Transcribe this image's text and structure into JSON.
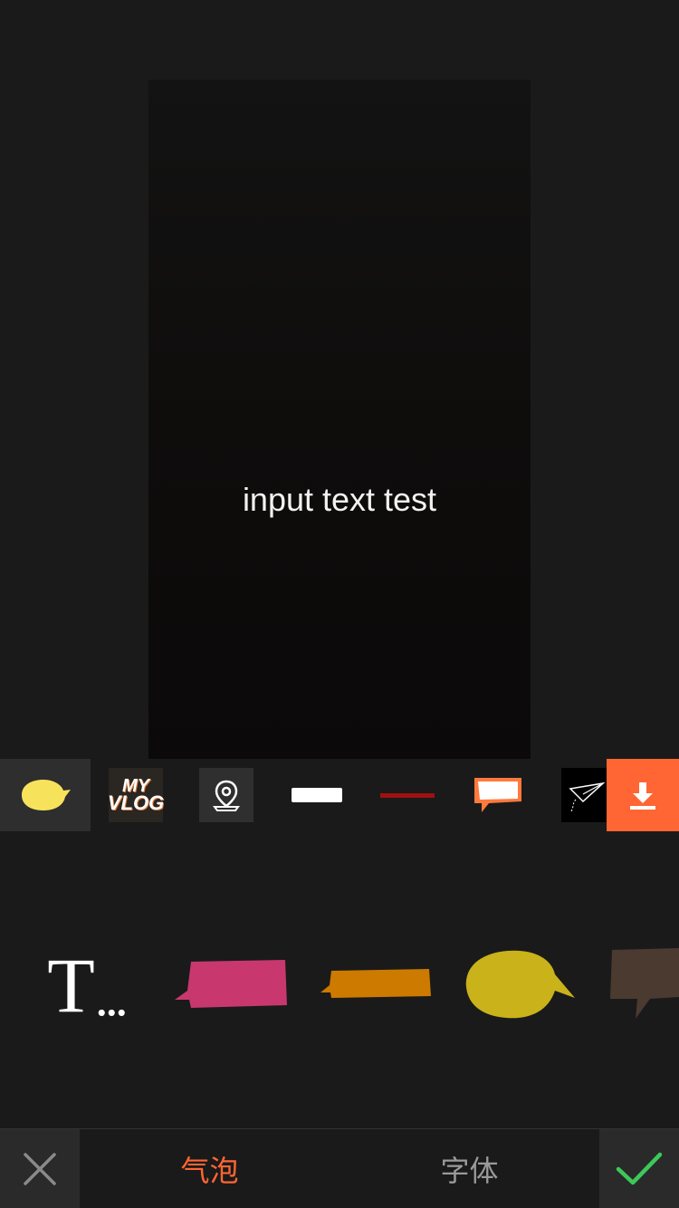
{
  "preview": {
    "overlay_text": "input text test"
  },
  "category_strip": {
    "items": [
      {
        "icon": "yellow-bubble-icon",
        "selected": true
      },
      {
        "icon": "my-vlog-icon",
        "text_line1": "MY",
        "text_line2": "VLOG"
      },
      {
        "icon": "location-pin-icon"
      },
      {
        "icon": "white-bar-icon"
      },
      {
        "icon": "red-line-icon"
      },
      {
        "icon": "orange-speech-bubble-icon"
      },
      {
        "icon": "paper-plane-icon"
      }
    ],
    "download_icon": "download-icon"
  },
  "styles": {
    "text_only_glyph": "T",
    "text_only_dots": "...",
    "items": [
      {
        "icon": "pink-rect-bubble-icon",
        "color": "#c8386e"
      },
      {
        "icon": "orange-rect-bubble-icon",
        "color": "#cc7a00"
      },
      {
        "icon": "yellow-round-bubble-icon",
        "color": "#c9b21a"
      },
      {
        "icon": "brown-speech-bubble-icon",
        "color": "#4a3a30"
      }
    ]
  },
  "bottom_bar": {
    "cancel_icon": "close-icon",
    "tab_bubble": "气泡",
    "tab_font": "字体",
    "confirm_icon": "check-icon"
  },
  "colors": {
    "accent": "#ff6633",
    "confirm": "#3cc85a",
    "background": "#1a1a1a"
  }
}
